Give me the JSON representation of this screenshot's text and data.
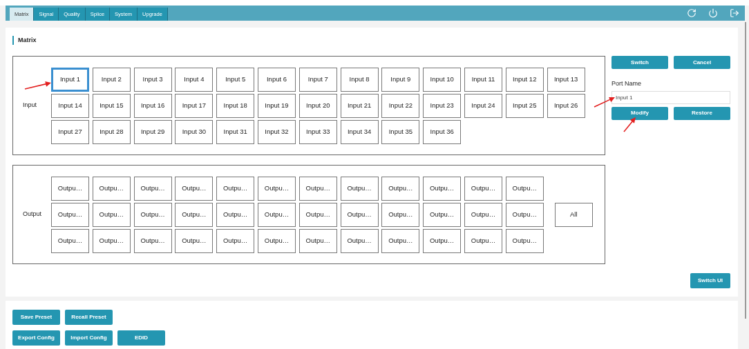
{
  "tabs": [
    {
      "label": "Matrix",
      "selected": true
    },
    {
      "label": "Signal",
      "selected": false
    },
    {
      "label": "Quality",
      "selected": false
    },
    {
      "label": "Splice",
      "selected": false
    },
    {
      "label": "System",
      "selected": false
    },
    {
      "label": "Upgrade",
      "selected": false
    }
  ],
  "section_title": "Matrix",
  "input_panel": {
    "label": "Input",
    "ports": [
      {
        "label": "Input 1",
        "selected": true
      },
      {
        "label": "Input 2",
        "selected": false
      },
      {
        "label": "Input 3",
        "selected": false
      },
      {
        "label": "Input 4",
        "selected": false
      },
      {
        "label": "Input 5",
        "selected": false
      },
      {
        "label": "Input 6",
        "selected": false
      },
      {
        "label": "Input 7",
        "selected": false
      },
      {
        "label": "Input 8",
        "selected": false
      },
      {
        "label": "Input 9",
        "selected": false
      },
      {
        "label": "Input 10",
        "selected": false
      },
      {
        "label": "Input 11",
        "selected": false
      },
      {
        "label": "Input 12",
        "selected": false
      },
      {
        "label": "Input 13",
        "selected": false
      },
      {
        "label": "Input 14",
        "selected": false
      },
      {
        "label": "Input 15",
        "selected": false
      },
      {
        "label": "Input 16",
        "selected": false
      },
      {
        "label": "Input 17",
        "selected": false
      },
      {
        "label": "Input 18",
        "selected": false
      },
      {
        "label": "Input 19",
        "selected": false
      },
      {
        "label": "Input 20",
        "selected": false
      },
      {
        "label": "Input 21",
        "selected": false
      },
      {
        "label": "Input 22",
        "selected": false
      },
      {
        "label": "Input 23",
        "selected": false
      },
      {
        "label": "Input 24",
        "selected": false
      },
      {
        "label": "Input 25",
        "selected": false
      },
      {
        "label": "Input 26",
        "selected": false
      },
      {
        "label": "Input 27",
        "selected": false
      },
      {
        "label": "Input 28",
        "selected": false
      },
      {
        "label": "Input 29",
        "selected": false
      },
      {
        "label": "Input 30",
        "selected": false
      },
      {
        "label": "Input 31",
        "selected": false
      },
      {
        "label": "Input 32",
        "selected": false
      },
      {
        "label": "Input 33",
        "selected": false
      },
      {
        "label": "Input 34",
        "selected": false
      },
      {
        "label": "Input 35",
        "selected": false
      },
      {
        "label": "Input 36",
        "selected": false
      }
    ]
  },
  "output_panel": {
    "label": "Output",
    "all_button": "All",
    "ports": [
      {
        "label": "Outpu…",
        "selected": false
      },
      {
        "label": "Outpu…",
        "selected": false
      },
      {
        "label": "Outpu…",
        "selected": false
      },
      {
        "label": "Outpu…",
        "selected": false
      },
      {
        "label": "Outpu…",
        "selected": false
      },
      {
        "label": "Outpu…",
        "selected": false
      },
      {
        "label": "Outpu…",
        "selected": false
      },
      {
        "label": "Outpu…",
        "selected": false
      },
      {
        "label": "Outpu…",
        "selected": false
      },
      {
        "label": "Outpu…",
        "selected": false
      },
      {
        "label": "Outpu…",
        "selected": false
      },
      {
        "label": "Outpu…",
        "selected": false
      },
      {
        "label": "Outpu…",
        "selected": false
      },
      {
        "label": "Outpu…",
        "selected": false
      },
      {
        "label": "Outpu…",
        "selected": false
      },
      {
        "label": "Outpu…",
        "selected": false
      },
      {
        "label": "Outpu…",
        "selected": false
      },
      {
        "label": "Outpu…",
        "selected": false
      },
      {
        "label": "Outpu…",
        "selected": false
      },
      {
        "label": "Outpu…",
        "selected": false
      },
      {
        "label": "Outpu…",
        "selected": false
      },
      {
        "label": "Outpu…",
        "selected": false
      },
      {
        "label": "Outpu…",
        "selected": false
      },
      {
        "label": "Outpu…",
        "selected": false
      },
      {
        "label": "Outpu…",
        "selected": false
      },
      {
        "label": "Outpu…",
        "selected": false
      },
      {
        "label": "Outpu…",
        "selected": false
      },
      {
        "label": "Outpu…",
        "selected": false
      },
      {
        "label": "Outpu…",
        "selected": false
      },
      {
        "label": "Outpu…",
        "selected": false
      },
      {
        "label": "Outpu…",
        "selected": false
      },
      {
        "label": "Outpu…",
        "selected": false
      },
      {
        "label": "Outpu…",
        "selected": false
      },
      {
        "label": "Outpu…",
        "selected": false
      },
      {
        "label": "Outpu…",
        "selected": false
      },
      {
        "label": "Outpu…",
        "selected": false
      }
    ]
  },
  "side_panel": {
    "top_buttons": [
      "Switch",
      "Cancel"
    ],
    "port_name_label": "Port Name",
    "port_name_value": "Input 1",
    "edit_buttons": [
      "Modify",
      "Restore"
    ],
    "switch_ui": "Switch UI"
  },
  "footer_buttons": [
    [
      "Save Preset",
      "Recall Preset"
    ],
    [
      "Export Config",
      "Import Config",
      "EDID"
    ]
  ]
}
